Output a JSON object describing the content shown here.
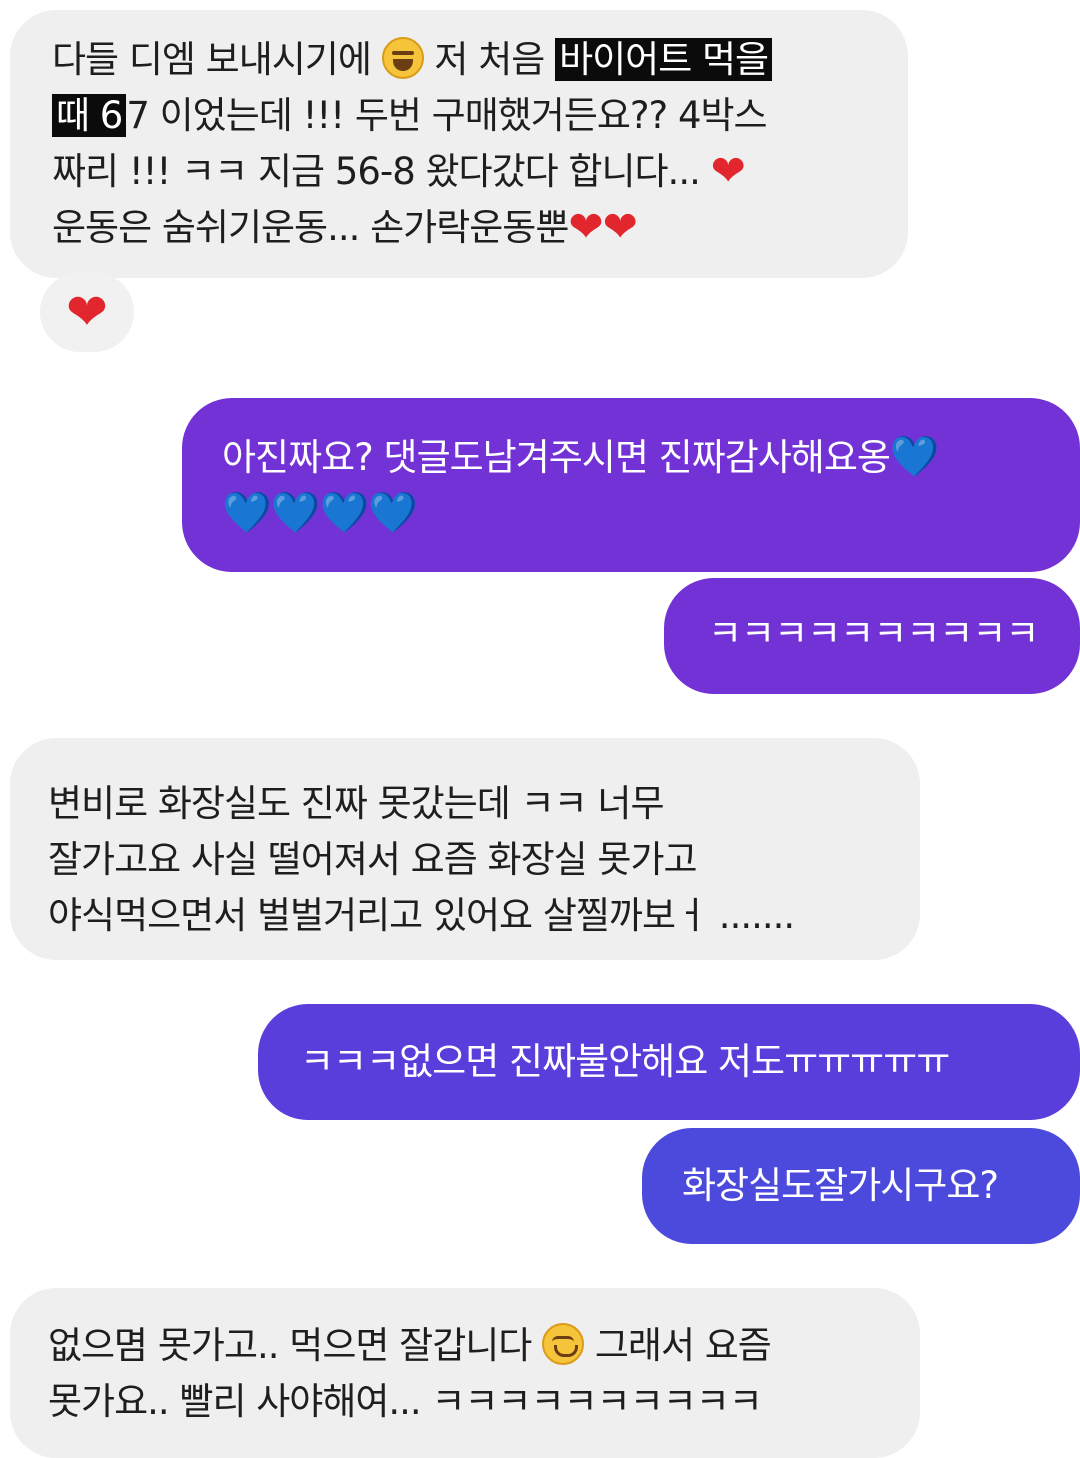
{
  "conversation": {
    "messages": [
      {
        "direction": "received",
        "lines": [
          {
            "pre": "다들 디엠 보내시기에",
            "emoji": "laughing-face",
            "mid": " 저 처음 ",
            "highlight": "바이어트 먹을"
          },
          {
            "highlight": "때 6",
            "post": "7 이었는데 !!! 두번 구매했거든요?? 4박스"
          },
          {
            "pre": "짜리 !!! ㅋㅋ 지금 56-8 왔다갔다 합니다...",
            "hearts": "❤"
          },
          {
            "pre": "운동은 숨쉬기운동... 손가락운동뿐",
            "hearts": "❤❤"
          }
        ],
        "reaction": "❤"
      },
      {
        "direction": "sent",
        "lines": [
          {
            "pre": "아진짜요? 댓글도남겨주시면 진짜감사해요옹",
            "hearts": "💙"
          },
          {
            "hearts": "💙💙💙💙"
          }
        ]
      },
      {
        "direction": "sent",
        "lines": [
          {
            "pre": "ㅋㅋㅋㅋㅋㅋㅋㅋㅋㅋ"
          }
        ]
      },
      {
        "direction": "received",
        "lines": [
          {
            "pre": "변비로 화장실도 진짜 못갔는데 ㅋㅋ 너무"
          },
          {
            "pre": "잘가고요 사실 떨어져서 요즘 화장실 못가고"
          },
          {
            "pre": "야식먹으면서 벌벌거리고 있어요 살찔까보ㅓ ......."
          }
        ]
      },
      {
        "direction": "sent",
        "lines": [
          {
            "pre": "ㅋㅋㅋ없으면 진짜불안해요 저도ㅠㅠㅠㅠㅠ"
          }
        ]
      },
      {
        "direction": "sent",
        "lines": [
          {
            "pre": "화장실도잘가시구요?"
          }
        ]
      },
      {
        "direction": "received",
        "lines": [
          {
            "pre": "없으몀 못가고.. 먹으면 잘갑니다",
            "emoji": "smiling-face",
            "mid": " 그래서 요즘"
          },
          {
            "pre": "못가요.. 빨리 사야해여... ㅋㅋㅋㅋㅋㅋㅋㅋㅋㅋ"
          }
        ]
      }
    ]
  },
  "colors": {
    "received_bubble": "#efefef",
    "sent_violet": "#7232d6",
    "sent_indigo": "#5b3ddc",
    "sent_blue": "#4c49dd",
    "heart_red": "#e2262e",
    "heart_light_blue": "#6fd2f0"
  }
}
